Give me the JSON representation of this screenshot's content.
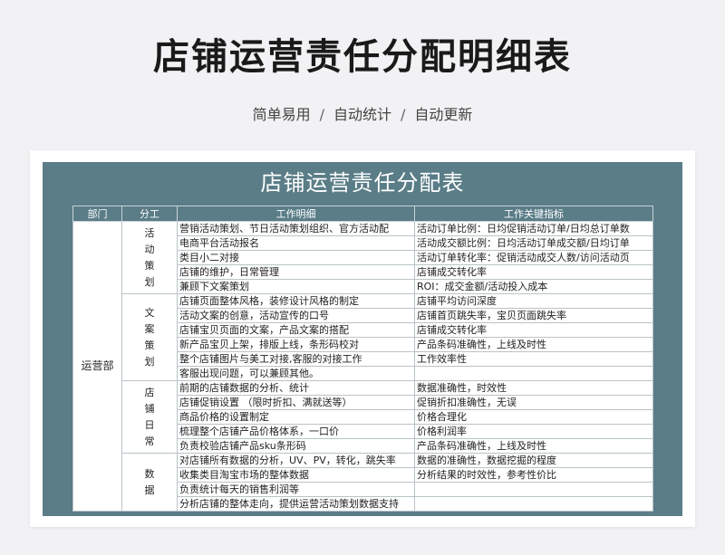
{
  "header": {
    "title": "店铺运营责任分配明细表",
    "tags": [
      "简单易用",
      "自动统计",
      "自动更新"
    ],
    "separator": "/"
  },
  "sheet": {
    "title": "店铺运营责任分配表",
    "columns": [
      "部门",
      "分工",
      "工作明细",
      "工作关键指标"
    ],
    "department": "运营部",
    "groups": [
      {
        "name": "活动策划",
        "rows": [
          {
            "detail": "营销活动策划、节日活动策划组织、官方活动配",
            "kpi": "活动订单比例：日均促销活动订单/日均总订单数"
          },
          {
            "detail": "电商平台活动报名",
            "kpi": "活动成交额比例：日均活动订单成交额/日均订单"
          },
          {
            "detail": "类目小二对接",
            "kpi": "活动订单转化率：促销活动成交人数/访问活动页"
          },
          {
            "detail": "店铺的维护，日常管理",
            "kpi": "店铺成交转化率"
          },
          {
            "detail": "兼顾下文案策划",
            "kpi": "ROI：成交金额/活动投入成本"
          }
        ]
      },
      {
        "name": "文案策划",
        "rows": [
          {
            "detail": "店铺页面整体风格，装修设计风格的制定",
            "kpi": "店铺平均访问深度"
          },
          {
            "detail": "活动文案的创意，活动宣传的口号",
            "kpi": "店铺首页跳失率，宝贝页面跳失率"
          },
          {
            "detail": "店铺宝贝页面的文案，产品文案的搭配",
            "kpi": "店铺成交转化率"
          },
          {
            "detail": "新产品宝贝上架，排版上线，条形码校对",
            "kpi": "产品条码准确性，上线及时性"
          },
          {
            "detail": "整个店铺图片与美工对接,客服的对接工作",
            "kpi": "工作效率性"
          },
          {
            "detail": "客服出现问题，可以兼顾其他。",
            "kpi": ""
          }
        ]
      },
      {
        "name": "店铺日常",
        "rows": [
          {
            "detail": "前期的店铺数据的分析、统计",
            "kpi": "数据准确性，时效性"
          },
          {
            "detail": "店铺促销设置 （限时折扣、满就送等）",
            "kpi": "促销折扣准确性，无误"
          },
          {
            "detail": "商品价格的设置制定",
            "kpi": "价格合理化"
          },
          {
            "detail": "梳理整个店铺产品价格体系，一口价",
            "kpi": "价格利润率"
          },
          {
            "detail": "负责校验店铺产品sku条形码",
            "kpi": "产品条码准确性，上线及时性"
          }
        ]
      },
      {
        "name": "数据",
        "rows": [
          {
            "detail": "对店铺所有数据的分析，UV、PV，转化，跳失率",
            "kpi": "数据的准确性，数据挖掘的程度"
          },
          {
            "detail": "收集类目淘宝市场的整体数据",
            "kpi": "分析结果的时效性，参考性价比"
          },
          {
            "detail": "负责统计每天的销售利润等",
            "kpi": ""
          },
          {
            "detail": "分析店铺的整体走向，提供运营活动策划数据支持",
            "kpi": ""
          }
        ]
      }
    ]
  }
}
